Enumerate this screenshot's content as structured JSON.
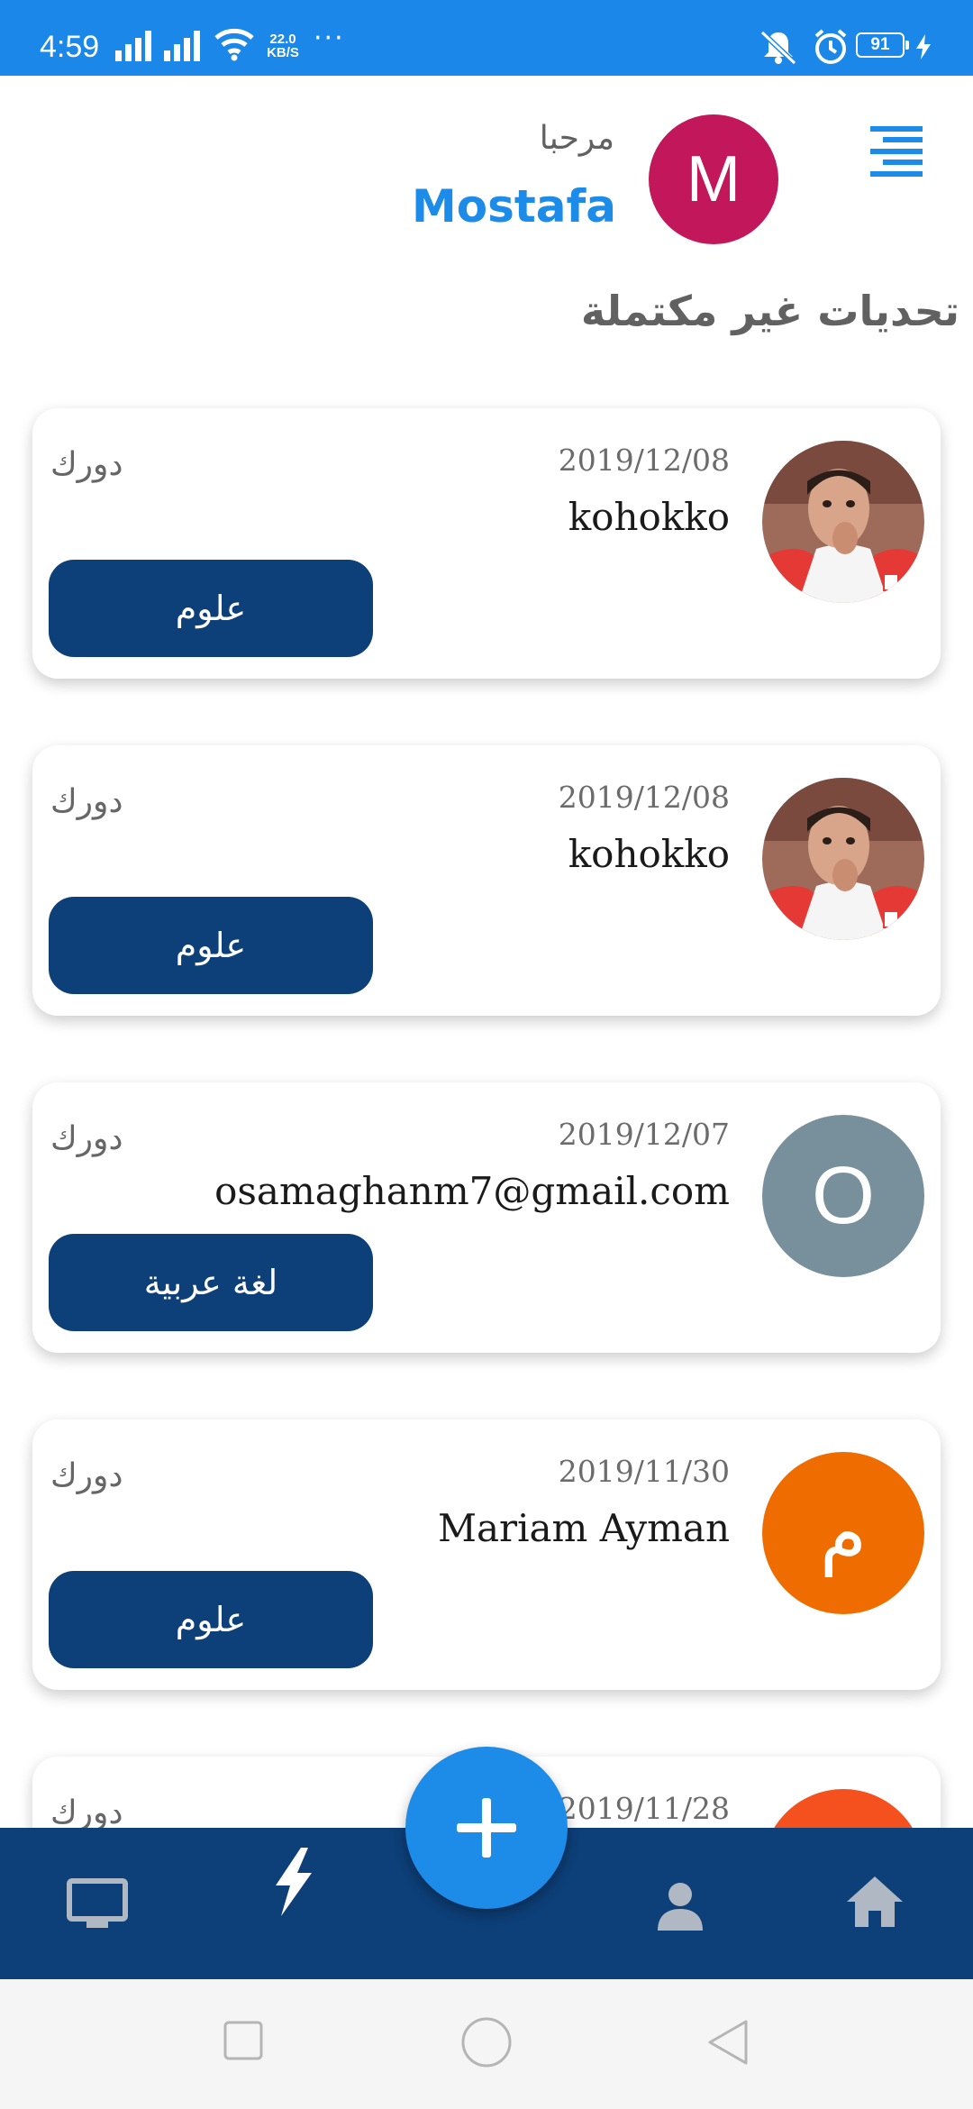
{
  "status_bar": {
    "time": "4:59",
    "speed_value": "22.0",
    "speed_unit": "KB/S",
    "more": "···",
    "battery": "91"
  },
  "header": {
    "greeting": "مرحبا",
    "user_name": "Mostafa",
    "avatar_letter": "M",
    "avatar_color": "#c2185b"
  },
  "section_title": "تحديات غير مكتملة",
  "cards": [
    {
      "date": "2019/12/08",
      "name": "kohokko",
      "type": "دورك",
      "subject": "علوم",
      "avatar": "photo",
      "avatar_letter": "",
      "avatar_color": "#b71c1c"
    },
    {
      "date": "2019/12/08",
      "name": "kohokko",
      "type": "دورك",
      "subject": "علوم",
      "avatar": "photo",
      "avatar_letter": "",
      "avatar_color": "#b71c1c"
    },
    {
      "date": "2019/12/07",
      "name": "osamaghanm7@gmail.com",
      "type": "دورك",
      "subject": "لغة عربية",
      "avatar": "letter",
      "avatar_letter": "O",
      "avatar_color": "#78909c"
    },
    {
      "date": "2019/11/30",
      "name": "Mariam Ayman",
      "type": "دورك",
      "subject": "علوم",
      "avatar": "letter",
      "avatar_letter": "م",
      "avatar_color": "#ef6c00"
    },
    {
      "date": "2019/11/28",
      "name": "",
      "type": "دورك",
      "subject": "",
      "avatar": "letter",
      "avatar_letter": "",
      "avatar_color": "#f4511e"
    }
  ],
  "bottom_nav": {
    "items": [
      "tv-icon",
      "lightning-icon",
      "add-icon",
      "person-icon",
      "home-icon"
    ],
    "background": "#0d3f78",
    "fab_color": "#1d8be8"
  },
  "colors": {
    "accent": "#1d8be8",
    "status_bar": "#1a87e9",
    "subject_button": "#0d3f78"
  }
}
